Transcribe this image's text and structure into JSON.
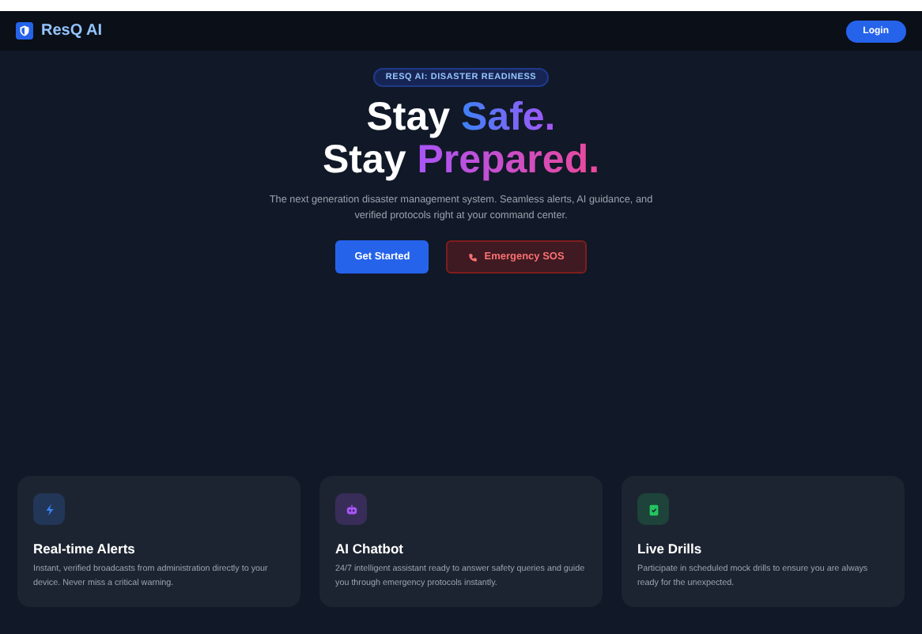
{
  "nav": {
    "brand": "ResQ AI",
    "login": "Login"
  },
  "hero": {
    "badge": "RESQ AI: DISASTER READINESS",
    "headline": [
      {
        "plain": "Stay",
        "accent": "Safe."
      },
      {
        "plain": "Stay",
        "accent": "Prepared."
      }
    ],
    "subtitle": "The next generation disaster management system. Seamless alerts, AI guidance, and verified protocols right at your command center.",
    "primary": "Get Started",
    "secondary": "Emergency SOS"
  },
  "features": [
    {
      "kind": "bolt",
      "color": "#3b82f6",
      "title": "Real-time Alerts",
      "text": "Instant, verified broadcasts from administration directly to your device. Never miss a critical warning."
    },
    {
      "kind": "bot",
      "color": "#a855f7",
      "title": "AI Chatbot",
      "text": "24/7 intelligent assistant ready to answer safety queries and guide you through emergency protocols instantly."
    },
    {
      "kind": "clipboard",
      "color": "#22c55e",
      "title": "Live Drills",
      "text": "Participate in scheduled mock drills to ensure you are always ready for the unexpected."
    }
  ]
}
